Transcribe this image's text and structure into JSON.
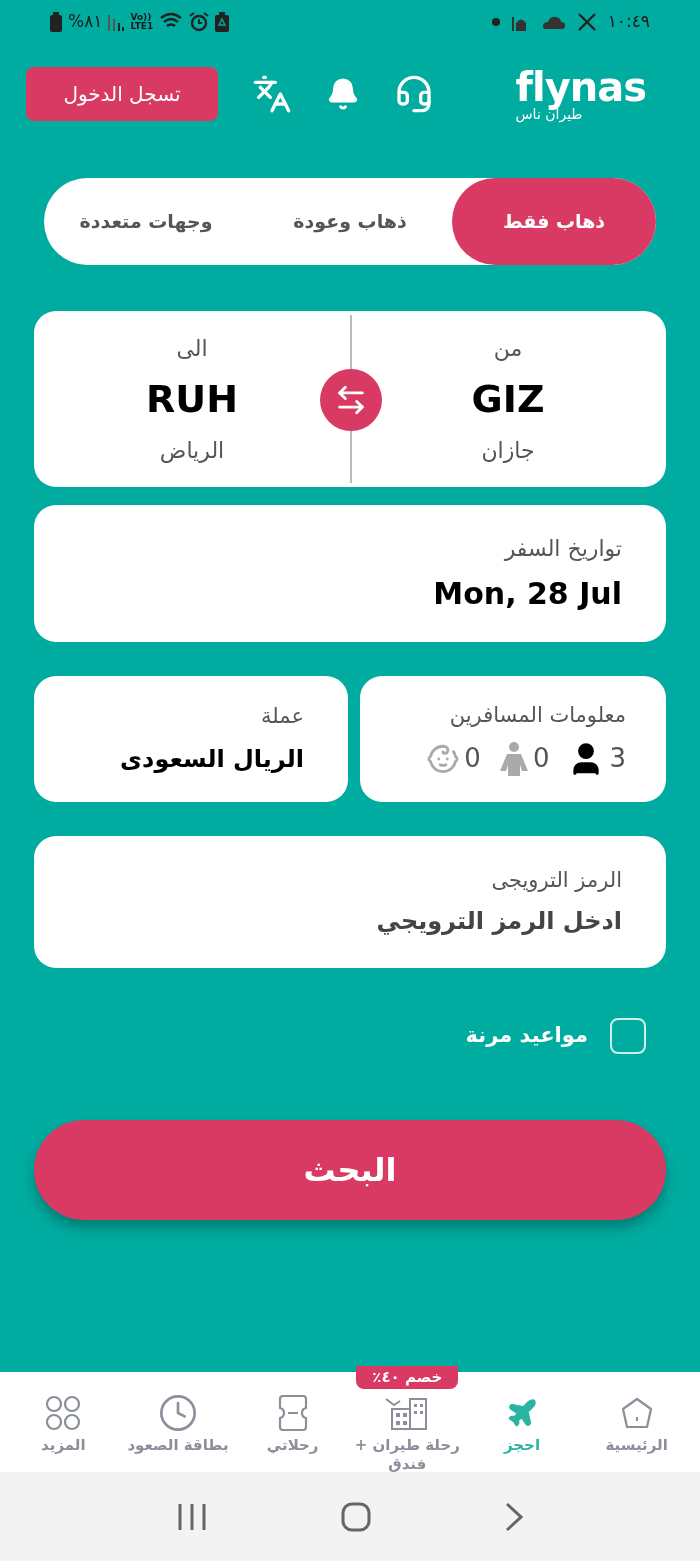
{
  "status_bar": {
    "battery": "%٨١",
    "volte": "Vo))",
    "network": "LTE1",
    "time": "١٠:٤٩"
  },
  "header": {
    "logo": "flynas",
    "logo_subtitle": "طيران ناس",
    "login_button": "تسجل الدخول"
  },
  "trip_tabs": [
    {
      "label": "ذهاب فقط",
      "selected": true
    },
    {
      "label": "ذهاب وعودة",
      "selected": false
    },
    {
      "label": "وجهات متعددة",
      "selected": false
    }
  ],
  "route": {
    "from": {
      "label": "من",
      "code": "GIZ",
      "city": "جازان"
    },
    "to": {
      "label": "الى",
      "code": "RUH",
      "city": "الرياض"
    }
  },
  "dates": {
    "label": "تواريخ السفر",
    "value": "Mon, 28 Jul"
  },
  "passengers": {
    "label": "معلومات المسافرين",
    "counts": [
      {
        "kind": "adult",
        "count": "3"
      },
      {
        "kind": "child",
        "count": "0"
      },
      {
        "kind": "infant",
        "count": "0"
      }
    ]
  },
  "currency": {
    "label": "عملة",
    "value": "الريال السعودى"
  },
  "promo": {
    "label": "الرمز الترويجى",
    "placeholder": "ادخل الرمز الترويجي"
  },
  "flexible_dates": {
    "label": "مواعيد مرنة",
    "checked": false
  },
  "search_button": "البحث",
  "bottom_nav": [
    {
      "kind": "home",
      "label": "الرئيسية",
      "selected": false
    },
    {
      "kind": "book",
      "label": "احجز",
      "selected": true
    },
    {
      "kind": "hotel",
      "label": "رحلة طيران + فندق",
      "badge": "خصم ٤٠٪",
      "selected": false
    },
    {
      "kind": "trips",
      "label": "رحلاتي",
      "selected": false
    },
    {
      "kind": "boarding",
      "label": "بطاقة الصعود",
      "selected": false
    },
    {
      "kind": "more",
      "label": "المزيد",
      "selected": false
    }
  ]
}
